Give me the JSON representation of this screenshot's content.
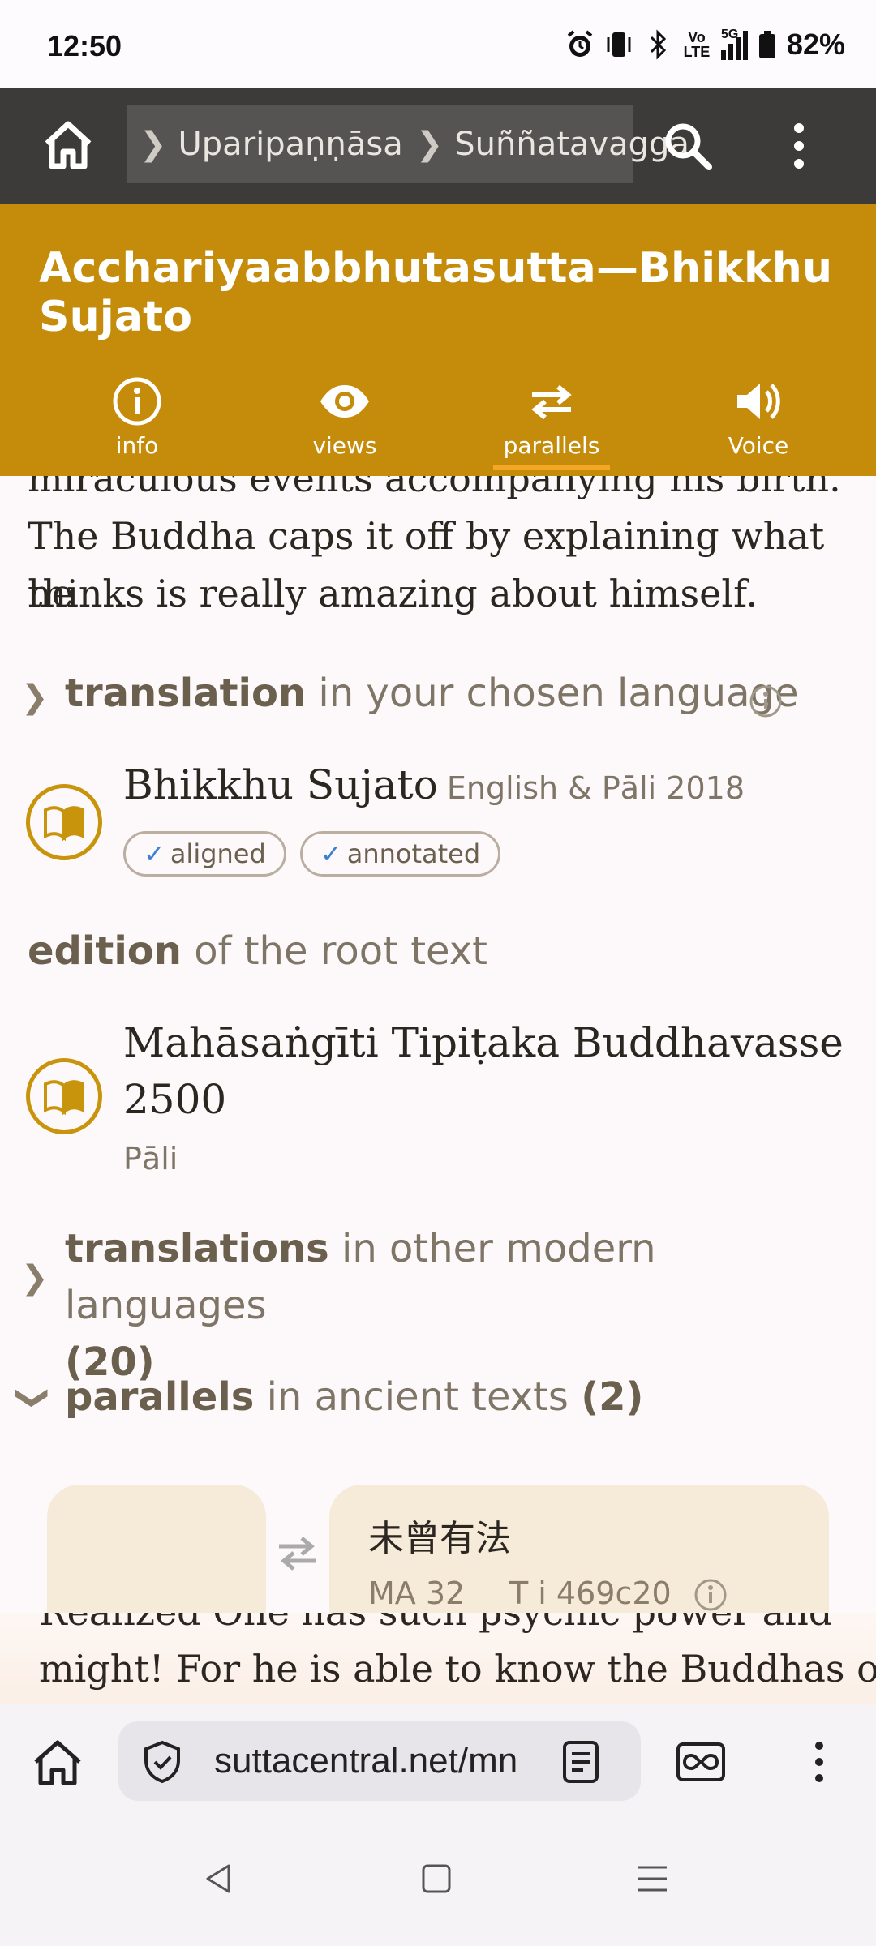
{
  "status_bar": {
    "time": "12:50",
    "battery": "82%",
    "icons": [
      "alarm-icon",
      "vibrate-icon",
      "bluetooth-icon",
      "volte-icon",
      "5g-signal-icon",
      "battery-icon"
    ],
    "volte_label": "Vo LTE",
    "network_label": "5G"
  },
  "nav": {
    "breadcrumb": [
      "Uparipaṇṇāsa",
      "Suññatavagga"
    ]
  },
  "title": "Acchariyaabbhutasutta—Bhikkhu Sujato",
  "tabs": [
    {
      "label": "info",
      "icon": "info-icon"
    },
    {
      "label": "views",
      "icon": "eye-icon"
    },
    {
      "label": "parallels",
      "icon": "parallels-icon",
      "active": true
    },
    {
      "label": "Voice",
      "icon": "speaker-icon"
    }
  ],
  "content": {
    "summary_line1": "miraculous events accompanying his birth.",
    "summary_line2": "The Buddha caps it off by explaining what he",
    "summary_line3": "thinks is really amazing about himself.",
    "translation_heading_bold": "translation",
    "translation_heading_rest": "in your chosen language",
    "translator_name": "Bhikkhu Sujato",
    "translator_meta": "English & Pāli 2018",
    "badges": [
      {
        "check": "✓",
        "label": "aligned"
      },
      {
        "check": "✓",
        "label": "annotated"
      }
    ],
    "edition_heading_bold": "edition",
    "edition_heading_rest": "of the root text",
    "edition_title_line1": "Mahāsaṅgīti Tipiṭaka Buddhavasse",
    "edition_title_line2": "2500",
    "edition_lang": "Pāli",
    "translations_heading_bold": "translations",
    "translations_heading_rest": "in other modern languages",
    "translations_count": "(20)",
    "parallels_heading_bold": "parallels",
    "parallels_heading_rest": "in ancient texts",
    "parallels_count": "(2)",
    "parallel_card": {
      "title": "未曾有法",
      "ref": "MA 32",
      "ref2": "T i 469c20"
    }
  },
  "peek_text": {
    "line1": "Realized One has such psychic power and",
    "line2": "might! For he is able to know the Buddhas of"
  },
  "browser": {
    "url": "suttacentral.net/mn"
  },
  "colors": {
    "header": "#3c3b3a",
    "title_bar": "#c48c0a",
    "active_underline": "#f5a623",
    "accent_gold": "#c8940b",
    "card_bg": "#f6ead8"
  }
}
